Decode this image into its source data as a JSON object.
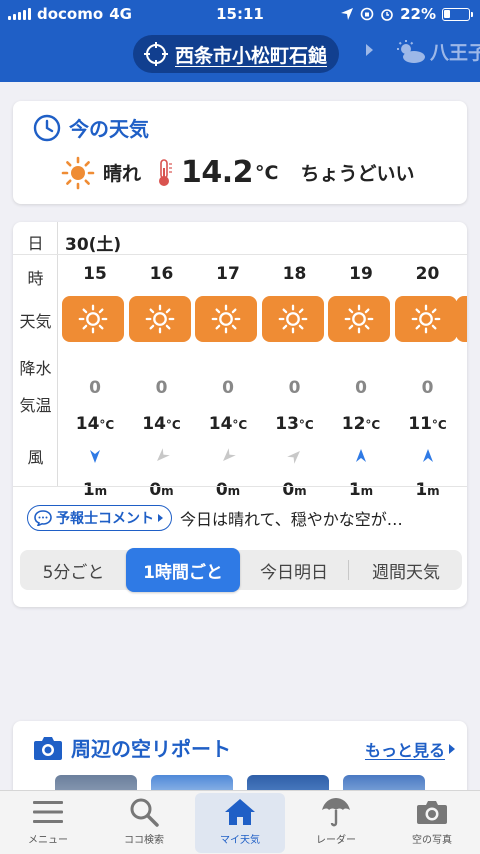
{
  "status_bar": {
    "carrier": "docomo",
    "network": "4G",
    "time": "15:11",
    "battery": "22%"
  },
  "header": {
    "location": "西条市小松町石鎚",
    "next_location": "八王子"
  },
  "current": {
    "title": "今の天気",
    "weather": "晴れ",
    "temperature": "14.2",
    "unit": "°C",
    "feel": "ちょうどいい",
    "icon": "sun-icon"
  },
  "forecast": {
    "labels": {
      "day": "日",
      "hour": "時",
      "weather": "天気",
      "rain": "降水",
      "temp": "気温",
      "wind": "風"
    },
    "date": "30(土)",
    "hours": [
      {
        "hour": "15",
        "weather": "sunny",
        "rain": "0",
        "temp": "14",
        "temp_unit": "°C",
        "wind_speed": "1",
        "wind_unit": "m",
        "wind_dir": "down"
      },
      {
        "hour": "16",
        "weather": "sunny",
        "rain": "0",
        "temp": "14",
        "temp_unit": "°C",
        "wind_speed": "0",
        "wind_unit": "m",
        "wind_dir": "down-left"
      },
      {
        "hour": "17",
        "weather": "sunny",
        "rain": "0",
        "temp": "14",
        "temp_unit": "°C",
        "wind_speed": "0",
        "wind_unit": "m",
        "wind_dir": "down-left"
      },
      {
        "hour": "18",
        "weather": "sunny",
        "rain": "0",
        "temp": "13",
        "temp_unit": "°C",
        "wind_speed": "0",
        "wind_unit": "m",
        "wind_dir": "up-right"
      },
      {
        "hour": "19",
        "weather": "sunny",
        "rain": "0",
        "temp": "12",
        "temp_unit": "°C",
        "wind_speed": "1",
        "wind_unit": "m",
        "wind_dir": "up"
      },
      {
        "hour": "20",
        "weather": "sunny",
        "rain": "0",
        "temp": "11",
        "temp_unit": "°C",
        "wind_speed": "1",
        "wind_unit": "m",
        "wind_dir": "up"
      }
    ],
    "comment_label": "予報士コメント",
    "comment_text": "今日は晴れて、穏やかな空が…",
    "segments": [
      "5分ごと",
      "1時間ごと",
      "今日明日",
      "週間天気"
    ],
    "active_segment": "1時間ごと"
  },
  "report": {
    "title": "周辺の空リポート",
    "more": "もっと見る"
  },
  "tabs": [
    {
      "label": "メニュー",
      "icon": "menu-icon"
    },
    {
      "label": "ココ検索",
      "icon": "search-icon"
    },
    {
      "label": "マイ天気",
      "icon": "home-icon"
    },
    {
      "label": "レーダー",
      "icon": "radar-umbrella-icon"
    },
    {
      "label": "空の写真",
      "icon": "camera-icon"
    }
  ],
  "colors": {
    "brand_blue": "#1f5fc6",
    "sunny_orange": "#ef8c34",
    "active_blue": "#2f7ae5"
  }
}
